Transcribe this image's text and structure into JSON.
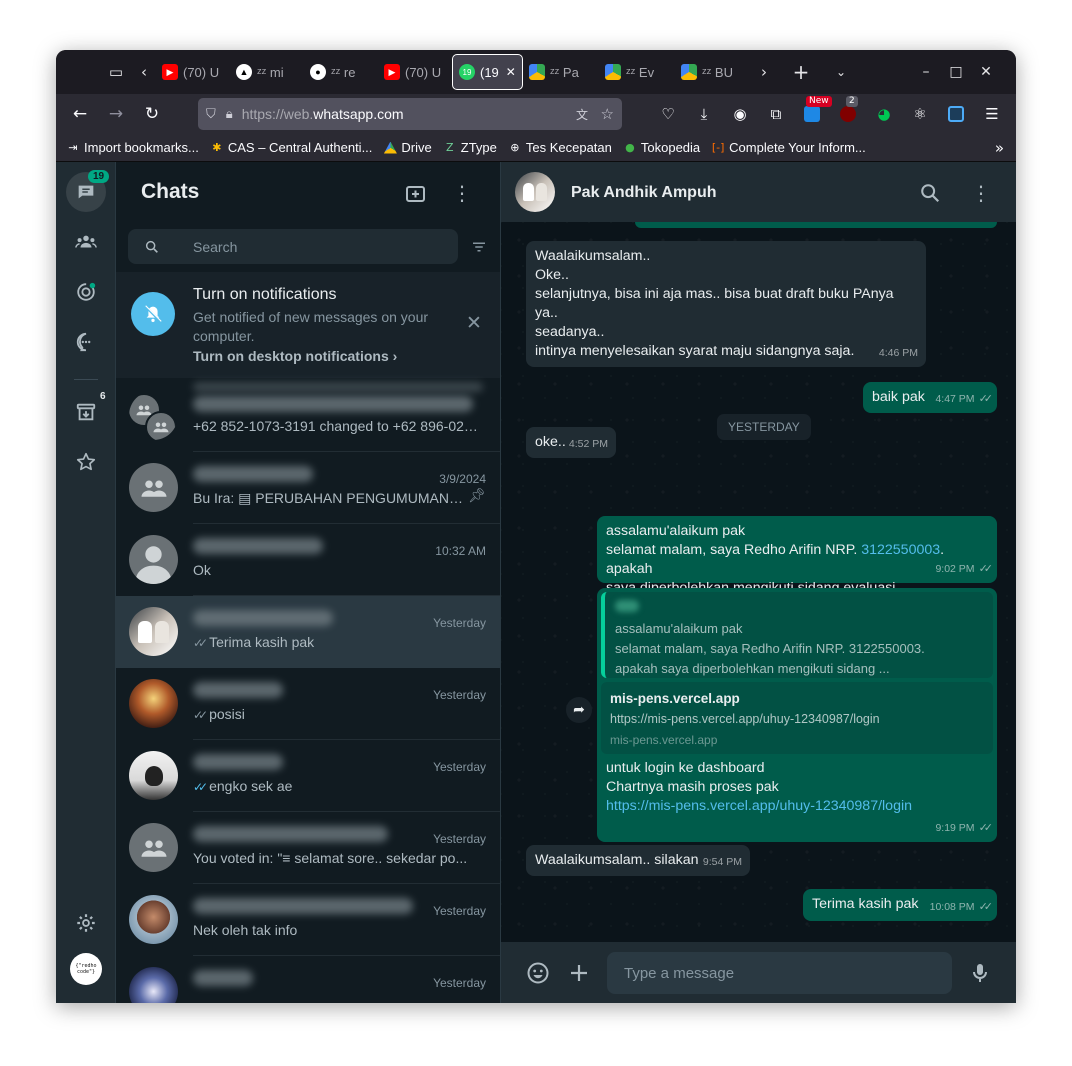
{
  "browser": {
    "tabs": [
      {
        "title": "(70) U",
        "icon": "youtube-icon",
        "color": "#ff0000"
      },
      {
        "title": "ᶻᶻ mi",
        "icon": "triangle-logo-icon",
        "color": "#000000"
      },
      {
        "title": "ᶻᶻ re",
        "icon": "github-icon",
        "color": "#ffffff"
      },
      {
        "title": "(70) U",
        "icon": "youtube-icon",
        "color": "#ff0000"
      },
      {
        "title": "(19",
        "icon": "whatsapp-icon",
        "color": "#25d366"
      },
      {
        "title": "ᶻᶻ Pa",
        "icon": "google-drive-icon",
        "color": "#34a853"
      },
      {
        "title": "ᶻᶻ Ev",
        "icon": "google-drive-icon",
        "color": "#34a853"
      },
      {
        "title": "ᶻᶻ BU",
        "icon": "google-drive-icon",
        "color": "#34a853"
      }
    ],
    "url_prefix": "https://web.",
    "url_domain": "whatsapp.com",
    "new_badge": "New",
    "ext_count": "2",
    "bookmarks": [
      {
        "label": "Import bookmarks...",
        "icon": "import-icon"
      },
      {
        "label": "CAS – Central Authenti...",
        "icon": "cas-icon"
      },
      {
        "label": "Drive",
        "icon": "google-drive-icon"
      },
      {
        "label": "ZType",
        "icon": "ztype-icon"
      },
      {
        "label": "Tes Kecepatan",
        "icon": "globe-icon"
      },
      {
        "label": "Tokopedia",
        "icon": "tokopedia-icon"
      },
      {
        "label": "Complete Your Inform...",
        "icon": "form-icon"
      }
    ]
  },
  "rail": {
    "chats_badge": "19",
    "archived_badge": "6",
    "profile_text": "{\"redho code\"}"
  },
  "sidebar": {
    "title": "Chats",
    "search_placeholder": "Search",
    "notification": {
      "title": "Turn on notifications",
      "body": "Get notified of new messages on your computer.",
      "action": "Turn on desktop notifications ›"
    },
    "chats": [
      {
        "time": "",
        "message": "+62 852-1073-3191 changed to +62 896-0251-5...",
        "tick": ""
      },
      {
        "time": "3/9/2024",
        "message": "Bu Ira: ▤ PERUBAHAN PENGUMUMAN JAM...",
        "tick": ""
      },
      {
        "time": "10:32 AM",
        "message": "Ok",
        "tick": ""
      },
      {
        "time": "Yesterday",
        "message": "Terima kasih pak",
        "tick": "gray"
      },
      {
        "time": "Yesterday",
        "message": "posisi",
        "tick": "gray"
      },
      {
        "time": "Yesterday",
        "message": "engko sek ae",
        "tick": "blue"
      },
      {
        "time": "Yesterday",
        "message": "You voted in: \"≡ selamat sore.. sekedar po...",
        "tick": ""
      },
      {
        "time": "Yesterday",
        "message": "Nek oleh tak info",
        "tick": ""
      },
      {
        "time": "Yesterday",
        "message": "",
        "tick": ""
      }
    ]
  },
  "conversation": {
    "contact_name": "Pak Andhik Ampuh",
    "date_chip": "YESTERDAY",
    "messages": [
      {
        "lines": [
          "Waalaikumsalam..",
          "Oke..",
          "selanjutnya, bisa ini aja mas.. bisa buat draft buku PAnya",
          "ya..",
          "seadanya..",
          "intinya menyelesaikan syarat maju sidangnya saja."
        ],
        "time": "4:46 PM"
      },
      {
        "text": "baik pak",
        "time": "4:47 PM"
      },
      {
        "text": "oke..",
        "time": "4:52 PM"
      },
      {
        "line1": "assalamu'alaikum pak",
        "line2a": "selamat malam,  saya Redho Arifin NRP. ",
        "nrp": "3122550003",
        "line2b": ". apakah",
        "line3": "saya diperbolehkan mengikuti sidang evaluasi",
        "time": "9:02 PM"
      },
      {
        "quote_lines": [
          "assalamu'alaikum pak",
          "selamat malam,  saya Redho Arifin NRP. 3122550003.",
          "apakah saya diperbolehkan mengikuti sidang ..."
        ],
        "preview_title": "mis-pens.vercel.app",
        "preview_url": "https://mis-pens.vercel.app/uhuy-12340987/login",
        "preview_domain": "mis-pens.vercel.app",
        "lines": [
          "untuk login ke dashboard",
          "Chartnya masih proses pak"
        ],
        "link": "https://mis-pens.vercel.app/uhuy-12340987/login",
        "time": "9:19 PM"
      },
      {
        "text": "Waalaikumsalam.. silakan",
        "time": "9:54 PM"
      },
      {
        "text": "Terima kasih pak",
        "time": "10:08 PM"
      }
    ],
    "composer_placeholder": "Type a message"
  },
  "colors": {
    "wa_bg": "#111b21",
    "panel": "#202c33",
    "outgoing": "#005c4b",
    "accent": "#00a884",
    "link": "#53bdeb"
  }
}
